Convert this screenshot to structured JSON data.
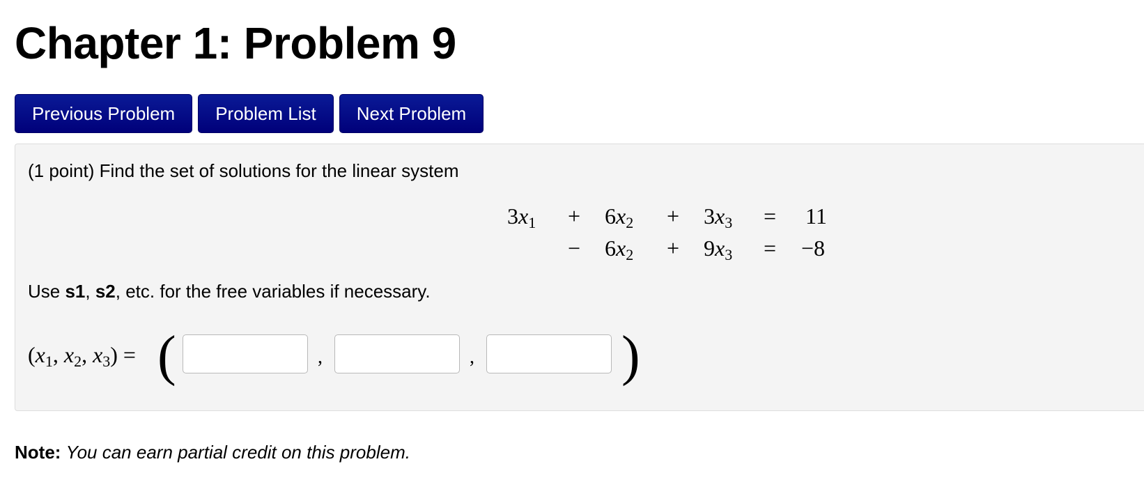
{
  "page": {
    "title": "Chapter 1: Problem 9"
  },
  "nav": {
    "previous_label": "Previous Problem",
    "list_label": "Problem List",
    "next_label": "Next Problem"
  },
  "problem": {
    "prompt": "(1 point) Find the set of solutions for the linear system",
    "equations": [
      {
        "x1_coef": "3",
        "op1": "+",
        "x2_coef": "6",
        "op2": "+",
        "x3_coef": "3",
        "equals": "=",
        "rhs": "11"
      },
      {
        "x1_coef": "",
        "op1": "−",
        "x2_coef": "6",
        "op2": "+",
        "x3_coef": "9",
        "equals": "=",
        "rhs": "−8"
      }
    ],
    "hint": {
      "before": "Use ",
      "var1": "s1",
      "sep": ", ",
      "var2": "s2",
      "after": ", etc. for the free variables if necessary."
    },
    "answer": {
      "open_paren": "(",
      "close_paren": ")",
      "var_x": "x",
      "equals": "=",
      "comma": ",",
      "inputs": [
        {
          "value": "",
          "placeholder": ""
        },
        {
          "value": "",
          "placeholder": ""
        },
        {
          "value": "",
          "placeholder": ""
        }
      ]
    }
  },
  "note": {
    "label": "Note:",
    "text": "You can earn partial credit on this problem."
  },
  "colors": {
    "button_bg": "#00007a",
    "button_text": "#ffffff",
    "panel_bg": "#f4f4f4",
    "panel_border": "#dddddd",
    "input_border": "#b8b8b8"
  }
}
